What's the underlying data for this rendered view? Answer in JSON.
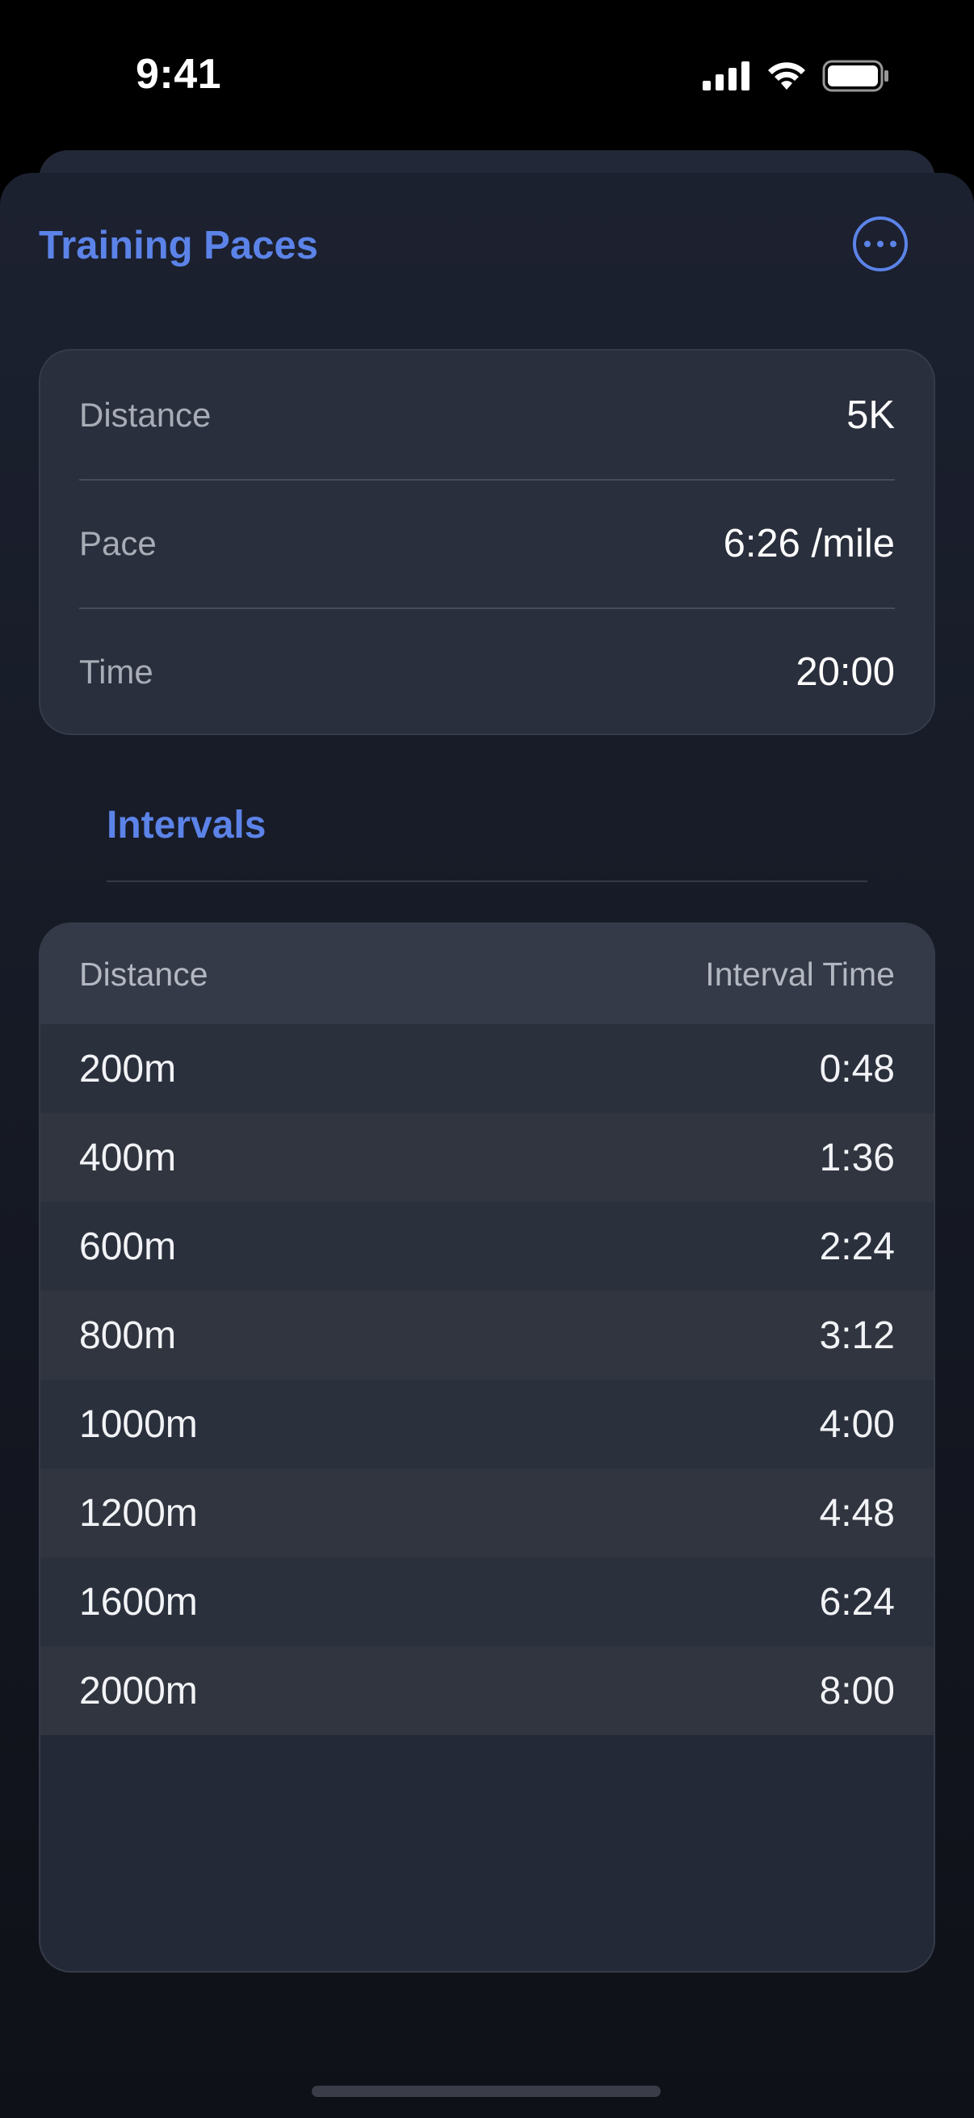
{
  "status_bar": {
    "time": "9:41",
    "icons": [
      "cellular-signal-icon",
      "wifi-icon",
      "battery-icon"
    ]
  },
  "nav": {
    "title": "Training Paces",
    "more_icon": "ellipsis-circle-icon"
  },
  "inputs": [
    {
      "label": "Distance",
      "value": "5K"
    },
    {
      "label": "Pace",
      "value": "6:26 /mile"
    },
    {
      "label": "Time",
      "value": "20:00"
    }
  ],
  "intervals": {
    "title": "Intervals",
    "headers": {
      "distance": "Distance",
      "time": "Interval Time"
    },
    "rows": [
      {
        "distance": "200m",
        "time": "0:48"
      },
      {
        "distance": "400m",
        "time": "1:36"
      },
      {
        "distance": "600m",
        "time": "2:24"
      },
      {
        "distance": "800m",
        "time": "3:12"
      },
      {
        "distance": "1000m",
        "time": "4:00"
      },
      {
        "distance": "1200m",
        "time": "4:48"
      },
      {
        "distance": "1600m",
        "time": "6:24"
      },
      {
        "distance": "2000m",
        "time": "8:00"
      }
    ]
  },
  "colors": {
    "accent": "#5b83e8",
    "background": "#161a25",
    "card": "#2a2f3d"
  }
}
